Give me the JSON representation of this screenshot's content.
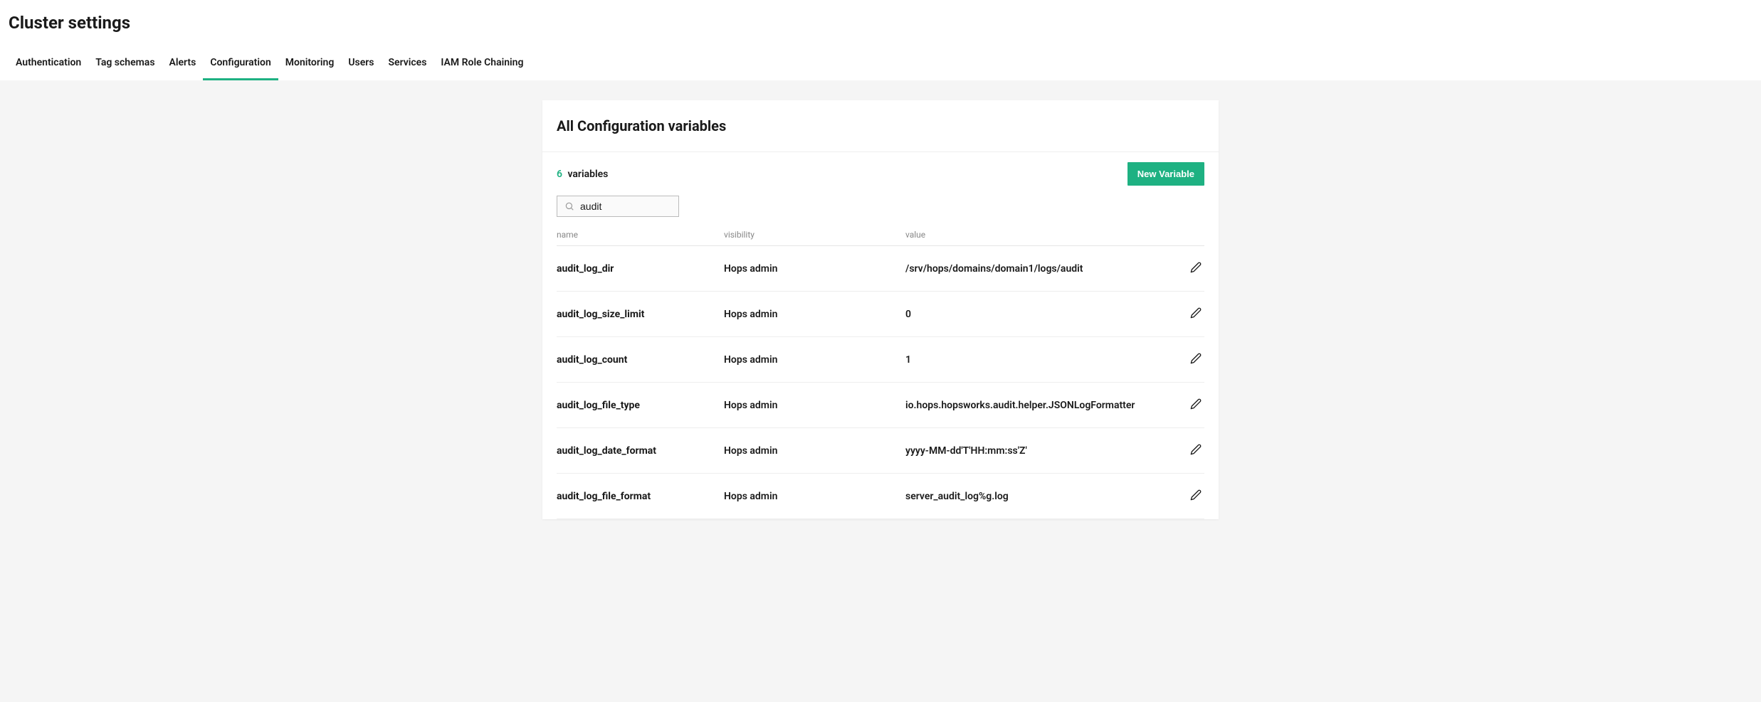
{
  "page_title": "Cluster settings",
  "tabs": [
    {
      "label": "Authentication",
      "active": false
    },
    {
      "label": "Tag schemas",
      "active": false
    },
    {
      "label": "Alerts",
      "active": false
    },
    {
      "label": "Configuration",
      "active": true
    },
    {
      "label": "Monitoring",
      "active": false
    },
    {
      "label": "Users",
      "active": false
    },
    {
      "label": "Services",
      "active": false
    },
    {
      "label": "IAM Role Chaining",
      "active": false
    }
  ],
  "panel_title": "All Configuration variables",
  "variable_count": "6",
  "variable_count_label": "variables",
  "new_variable_label": "New Variable",
  "search_value": "audit",
  "columns": {
    "name": "name",
    "visibility": "visibility",
    "value": "value"
  },
  "rows": [
    {
      "name": "audit_log_dir",
      "visibility": "Hops admin",
      "value": "/srv/hops/domains/domain1/logs/audit"
    },
    {
      "name": "audit_log_size_limit",
      "visibility": "Hops admin",
      "value": "0"
    },
    {
      "name": "audit_log_count",
      "visibility": "Hops admin",
      "value": "1"
    },
    {
      "name": "audit_log_file_type",
      "visibility": "Hops admin",
      "value": "io.hops.hopsworks.audit.helper.JSONLogFormatter"
    },
    {
      "name": "audit_log_date_format",
      "visibility": "Hops admin",
      "value": "yyyy-MM-dd'T'HH:mm:ss'Z'"
    },
    {
      "name": "audit_log_file_format",
      "visibility": "Hops admin",
      "value": "server_audit_log%g.log"
    }
  ]
}
